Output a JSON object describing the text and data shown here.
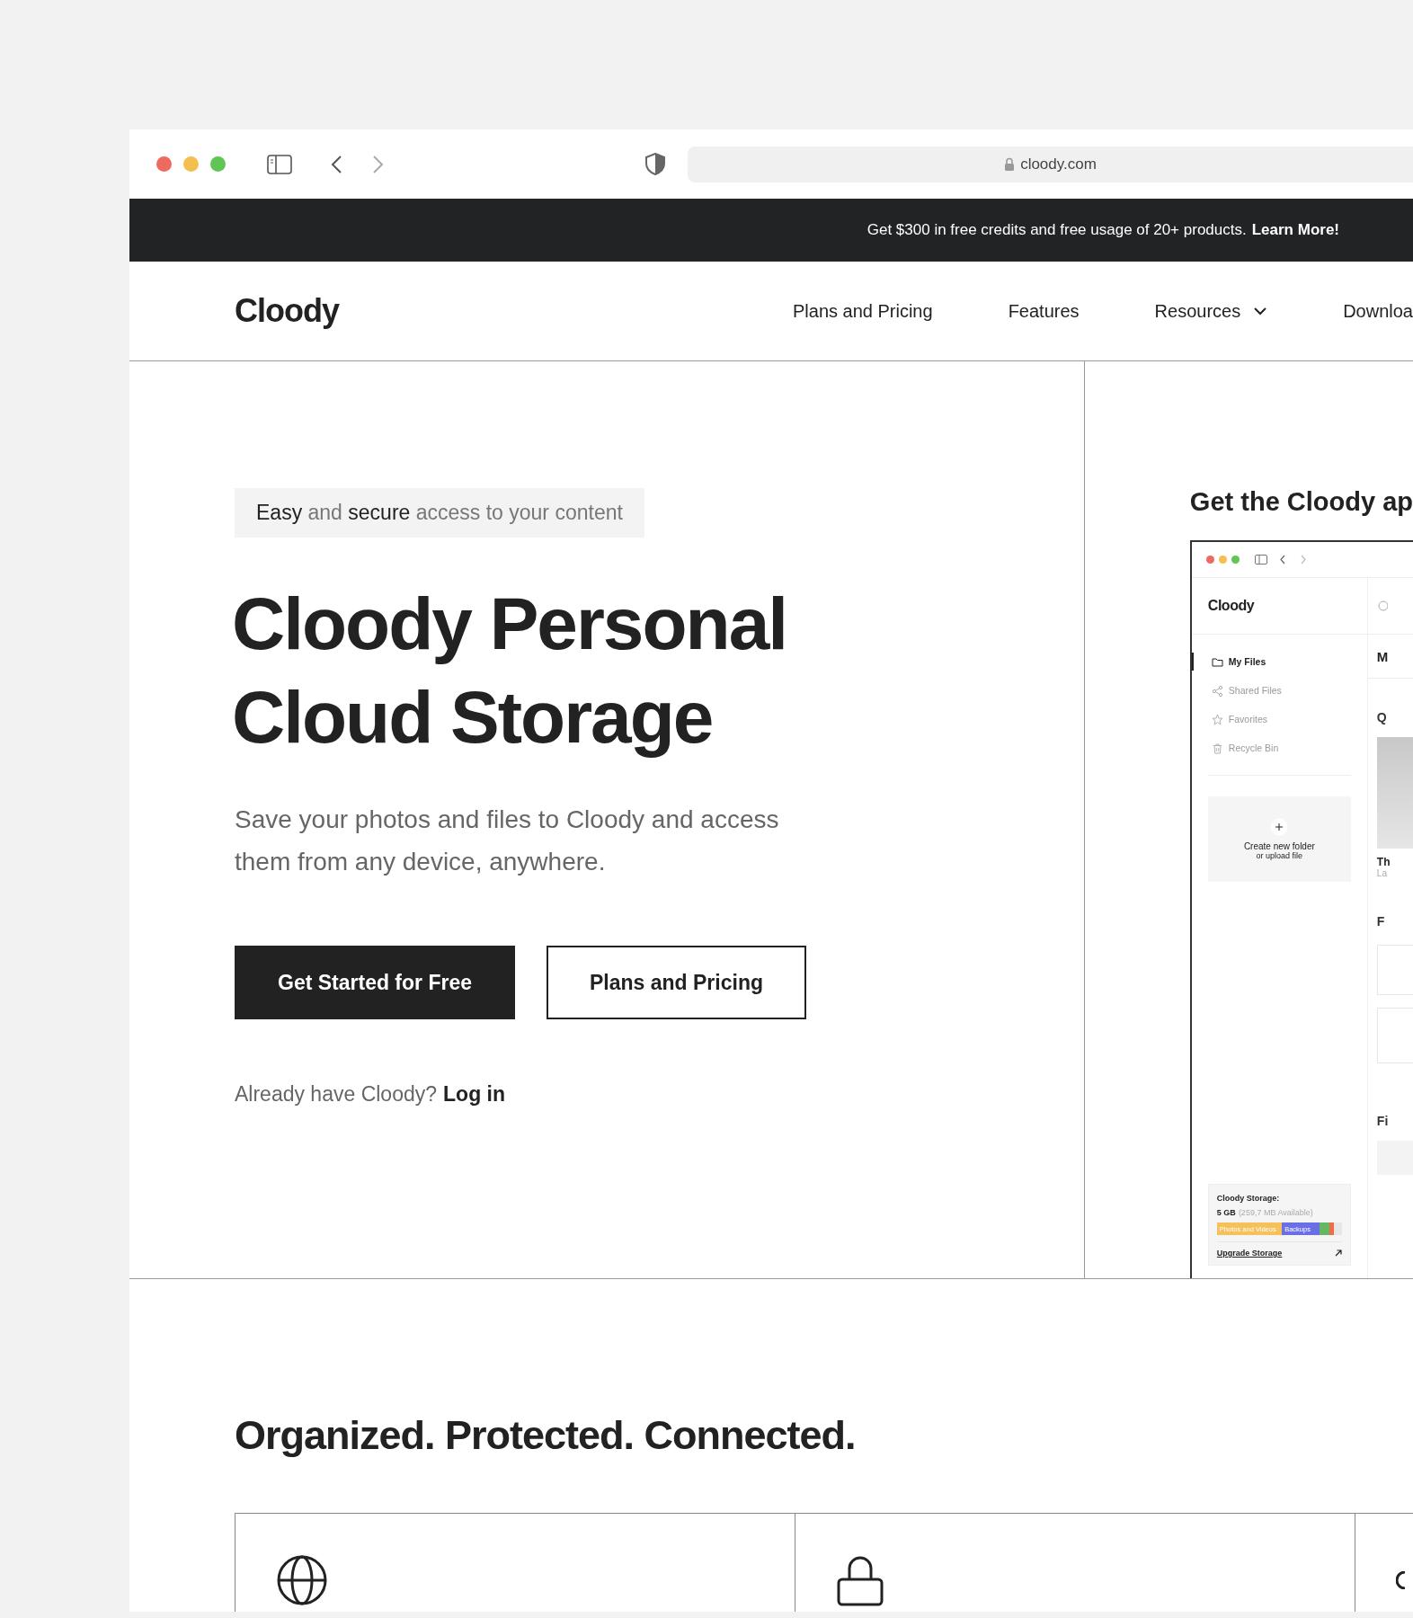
{
  "browser": {
    "url": "cloody.com"
  },
  "banner": {
    "text": "Get $300 in free credits and free usage of 20+ products.",
    "link": "Learn More!"
  },
  "nav": {
    "logo": "Cloody",
    "items": [
      {
        "label": "Plans and Pricing",
        "dropdown": false
      },
      {
        "label": "Features",
        "dropdown": false
      },
      {
        "label": "Resources",
        "dropdown": true
      },
      {
        "label": "Downloa",
        "dropdown": false
      }
    ]
  },
  "hero": {
    "tagline": "**Easy** and **secure** access to your content",
    "title": "Cloody Personal Cloud Storage",
    "subtitle": "Save your photos and files to Cloody and access them from any device, anywhere.",
    "buttons": [
      {
        "label": "Get Started for Free",
        "kind": "primary"
      },
      {
        "label": "Plans and Pricing",
        "kind": "secondary"
      }
    ],
    "login": {
      "text": "Already have Cloody?",
      "link": "Log in"
    }
  },
  "app_promo": {
    "title": "Get the Cloody ap",
    "mockup": {
      "logo": "Cloody",
      "nav": [
        {
          "label": "My Files",
          "kind": "folder",
          "selected": true
        },
        {
          "label": "Shared Files",
          "kind": "share",
          "selected": false
        },
        {
          "label": "Favorites",
          "kind": "star",
          "selected": false
        },
        {
          "label": "Recycle Bin",
          "kind": "trash",
          "selected": false
        }
      ],
      "create": {
        "text": "Create new folder",
        "subtext": "or upload file"
      },
      "storage": {
        "title": "Cloody Storage:",
        "total": "5 GB",
        "available": "(259,7 MB Available)",
        "link": "Upgrade Storage",
        "segments": [
          {
            "label": "Photos and Videos",
            "color": "#f6c15b"
          },
          {
            "label": "Backups",
            "color": "#6b6fe6"
          },
          {
            "color": "#62b865"
          },
          {
            "color": "#ef6b4a"
          }
        ]
      },
      "main": {
        "header": "M",
        "section_1": "Q",
        "item_title": "Th",
        "item_meta": "La",
        "section_2": "F",
        "section_3": "Fi"
      }
    }
  },
  "features": {
    "title": "Organized. Protected. Connected.",
    "cards": [
      {
        "kind": "globe"
      },
      {
        "kind": "lock"
      },
      {
        "kind": "chat"
      }
    ]
  }
}
